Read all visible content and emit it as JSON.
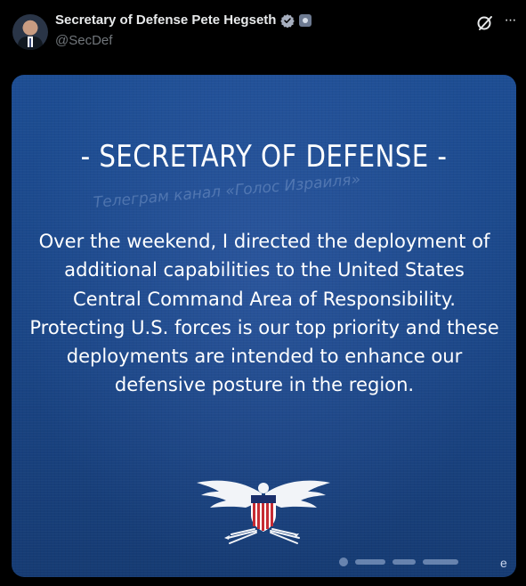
{
  "post": {
    "author_name": "Secretary of Defense Pete Hegseth",
    "handle": "@SecDef",
    "more_label": "···",
    "verified_color": "#a7afbf"
  },
  "image": {
    "title": "- SECRETARY OF DEFENSE -",
    "watermark": "Телеграм канал «Голос Израиля»",
    "body": "Over the weekend, I directed the deployment of additional capabilities to the United States Central Command Area of Responsibility. Protecting U.S. forces is our top priority and these deployments are intended to enhance our defensive posture in the region.",
    "corner_text": "e",
    "background_color": "#1b4a8e"
  }
}
